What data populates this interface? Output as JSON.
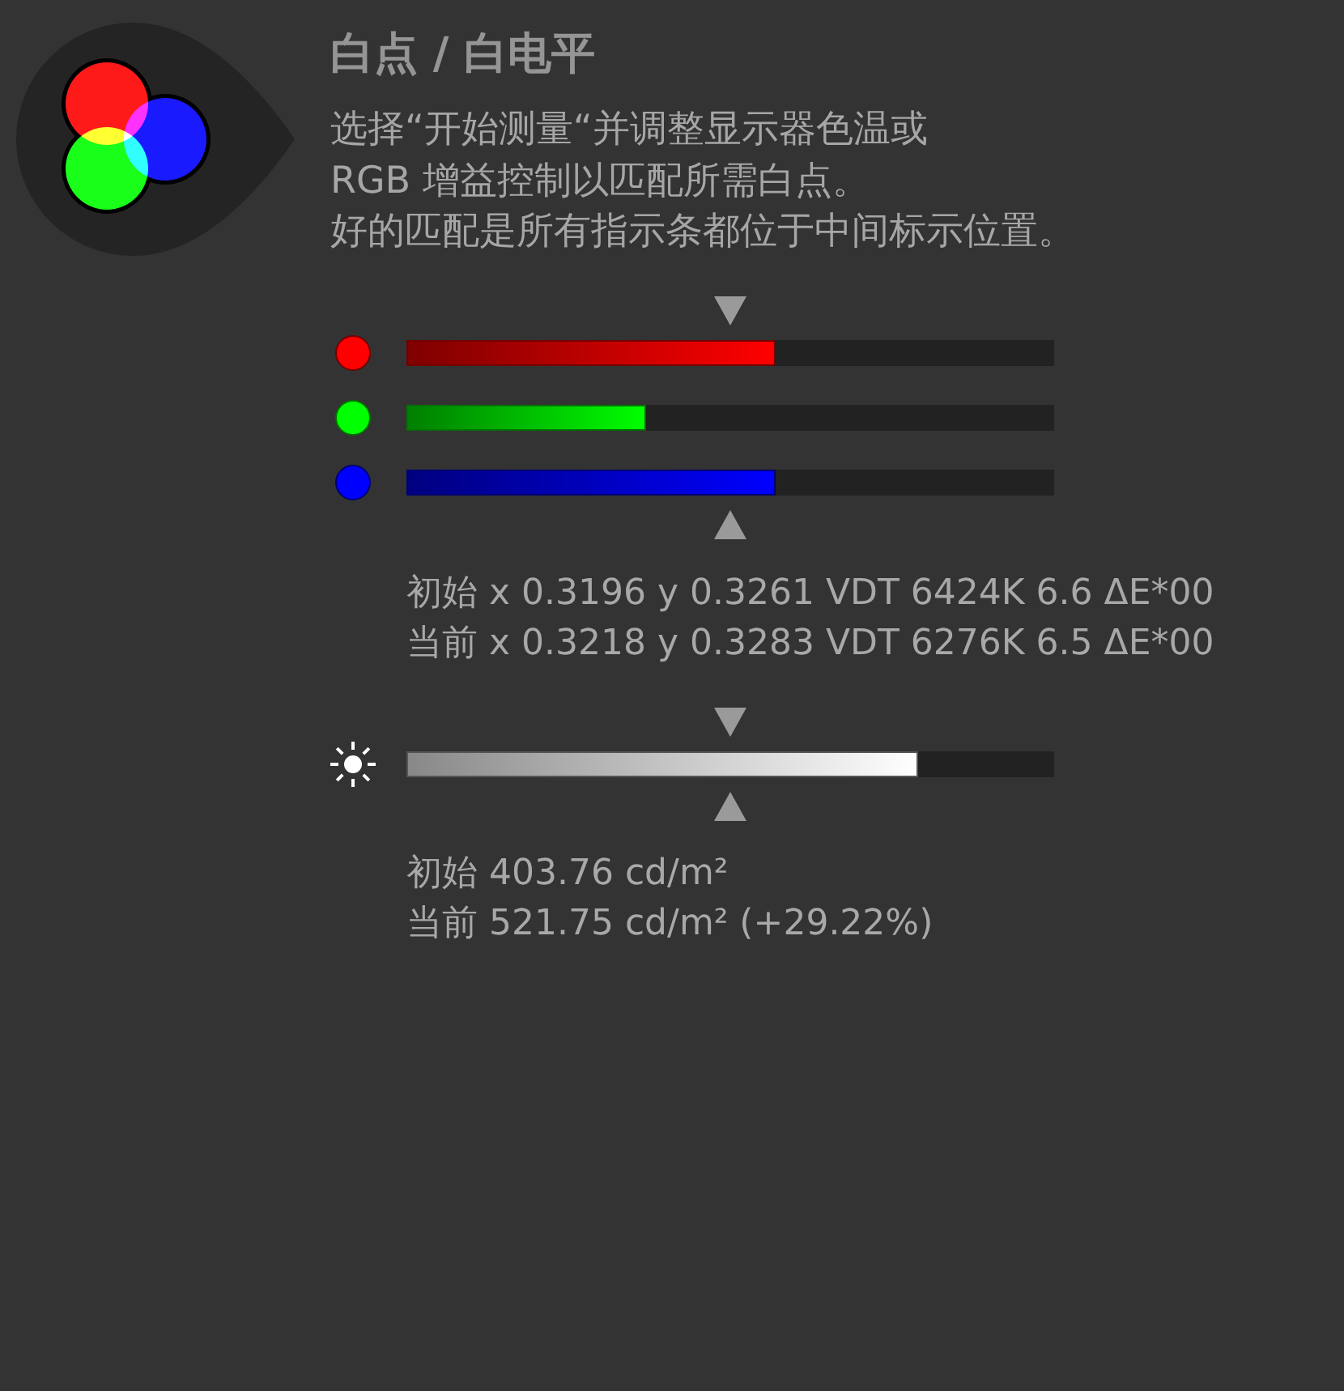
{
  "header": {
    "title": "白点 / 白电平",
    "description": [
      "选择“开始测量“并调整显示器色温或",
      "RGB 增益控制以匹配所需白点。",
      "好的匹配是所有指示条都位于中间标示位置。"
    ]
  },
  "rgb_bars": [
    {
      "color": "#ff0000",
      "level": 0.57
    },
    {
      "color": "#00ff00",
      "level": 0.37
    },
    {
      "color": "#0000ff",
      "level": 0.57
    }
  ],
  "chromaticity": {
    "initial": "初始 x 0.3196 y 0.3261 VDT 6424K 6.6 ΔE*00",
    "current": "当前 x 0.3218 y 0.3283 VDT 6276K 6.5 ΔE*00"
  },
  "brightness": {
    "level": 0.79,
    "initial": "初始 403.76 cd/m²",
    "current": "当前 521.75 cd/m² (+29.22%)"
  }
}
